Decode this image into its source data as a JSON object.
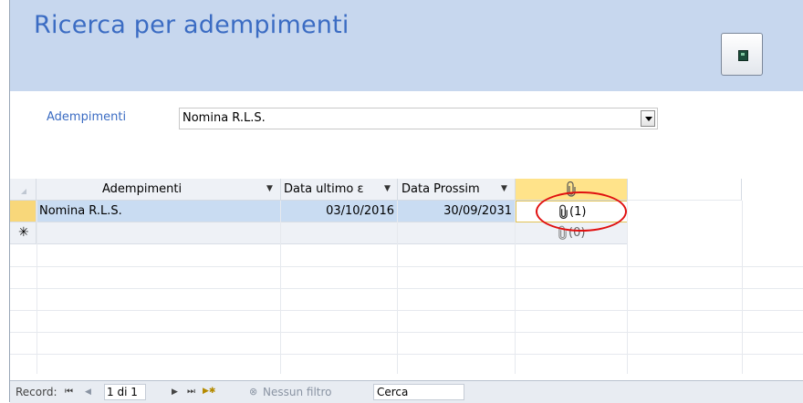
{
  "header": {
    "title": "Ricerca per adempimenti",
    "button_icon": "exit-door-icon"
  },
  "filter": {
    "label": "Adempimenti",
    "value": "Nomina R.L.S."
  },
  "table": {
    "columns": [
      "Adempimenti",
      "Data ultimo ε",
      "Data Prossim",
      "⌀"
    ],
    "attachment_icon": "paperclip-icon",
    "rows": [
      {
        "adempimento": "Nomina R.L.S.",
        "data_ultimo": "03/10/2016",
        "data_prossima": "30/09/2031",
        "allegati": "(1)"
      }
    ],
    "new_row": {
      "marker": "✳",
      "allegati": "(0)"
    }
  },
  "navigation": {
    "label": "Record:",
    "first": "⏮",
    "prev": "◀",
    "position": "1 di 1",
    "next": "▶",
    "last": "⏭",
    "new": "▶✱",
    "filter": "Nessun filtro",
    "search": "Cerca"
  },
  "colors": {
    "title": "#3b6cc3",
    "header_bg": "#c7d7ee",
    "selected_row": "#c9dcf2",
    "annotation": "#e01010"
  }
}
